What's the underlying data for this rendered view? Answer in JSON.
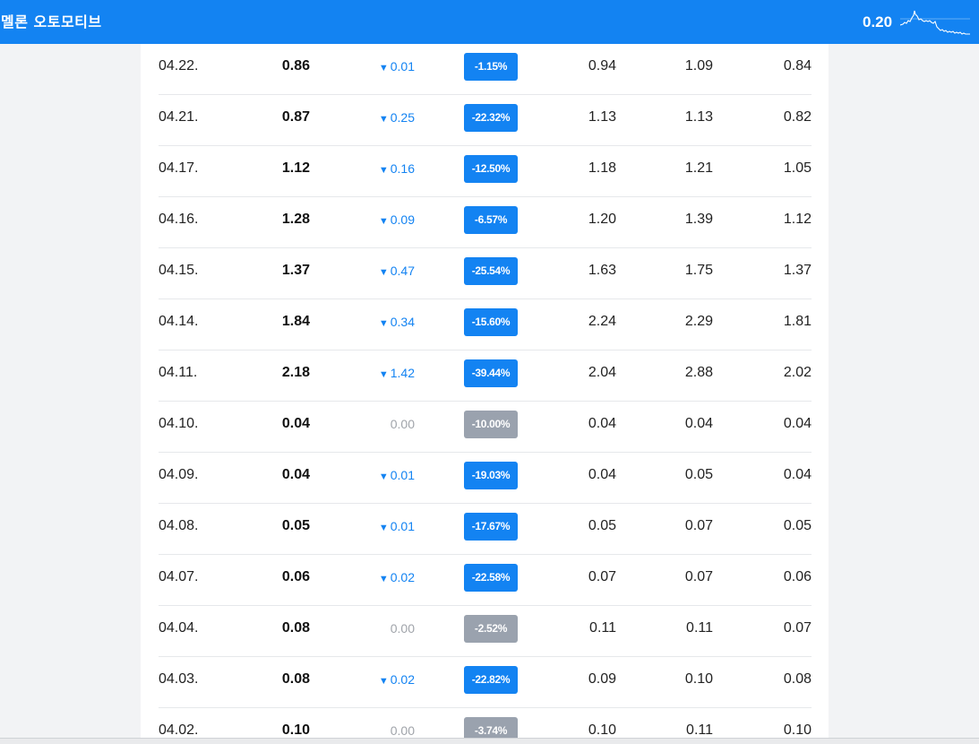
{
  "header": {
    "stock_name": "멜론 오토모티브",
    "current_price": "0.20",
    "accent_color": "#1383f2",
    "sparkline_icon": "price-sparkline"
  },
  "colors": {
    "down": "#1383f2",
    "flat": "#9aa2ae",
    "flat_text": "#a0a4aa"
  },
  "rows": [
    {
      "date": "04.22.",
      "close": "0.86",
      "change": "0.01",
      "dir": "down",
      "pct": "-1.15%",
      "open": "0.94",
      "high": "1.09",
      "low": "0.84"
    },
    {
      "date": "04.21.",
      "close": "0.87",
      "change": "0.25",
      "dir": "down",
      "pct": "-22.32%",
      "open": "1.13",
      "high": "1.13",
      "low": "0.82"
    },
    {
      "date": "04.17.",
      "close": "1.12",
      "change": "0.16",
      "dir": "down",
      "pct": "-12.50%",
      "open": "1.18",
      "high": "1.21",
      "low": "1.05"
    },
    {
      "date": "04.16.",
      "close": "1.28",
      "change": "0.09",
      "dir": "down",
      "pct": "-6.57%",
      "open": "1.20",
      "high": "1.39",
      "low": "1.12"
    },
    {
      "date": "04.15.",
      "close": "1.37",
      "change": "0.47",
      "dir": "down",
      "pct": "-25.54%",
      "open": "1.63",
      "high": "1.75",
      "low": "1.37"
    },
    {
      "date": "04.14.",
      "close": "1.84",
      "change": "0.34",
      "dir": "down",
      "pct": "-15.60%",
      "open": "2.24",
      "high": "2.29",
      "low": "1.81"
    },
    {
      "date": "04.11.",
      "close": "2.18",
      "change": "1.42",
      "dir": "down",
      "pct": "-39.44%",
      "open": "2.04",
      "high": "2.88",
      "low": "2.02"
    },
    {
      "date": "04.10.",
      "close": "0.04",
      "change": "0.00",
      "dir": "flat",
      "pct": "-10.00%",
      "open": "0.04",
      "high": "0.04",
      "low": "0.04"
    },
    {
      "date": "04.09.",
      "close": "0.04",
      "change": "0.01",
      "dir": "down",
      "pct": "-19.03%",
      "open": "0.04",
      "high": "0.05",
      "low": "0.04"
    },
    {
      "date": "04.08.",
      "close": "0.05",
      "change": "0.01",
      "dir": "down",
      "pct": "-17.67%",
      "open": "0.05",
      "high": "0.07",
      "low": "0.05"
    },
    {
      "date": "04.07.",
      "close": "0.06",
      "change": "0.02",
      "dir": "down",
      "pct": "-22.58%",
      "open": "0.07",
      "high": "0.07",
      "low": "0.06"
    },
    {
      "date": "04.04.",
      "close": "0.08",
      "change": "0.00",
      "dir": "flat",
      "pct": "-2.52%",
      "open": "0.11",
      "high": "0.11",
      "low": "0.07"
    },
    {
      "date": "04.03.",
      "close": "0.08",
      "change": "0.02",
      "dir": "down",
      "pct": "-22.82%",
      "open": "0.09",
      "high": "0.10",
      "low": "0.08"
    },
    {
      "date": "04.02.",
      "close": "0.10",
      "change": "0.00",
      "dir": "flat",
      "pct": "-3.74%",
      "open": "0.10",
      "high": "0.11",
      "low": "0.10"
    }
  ]
}
